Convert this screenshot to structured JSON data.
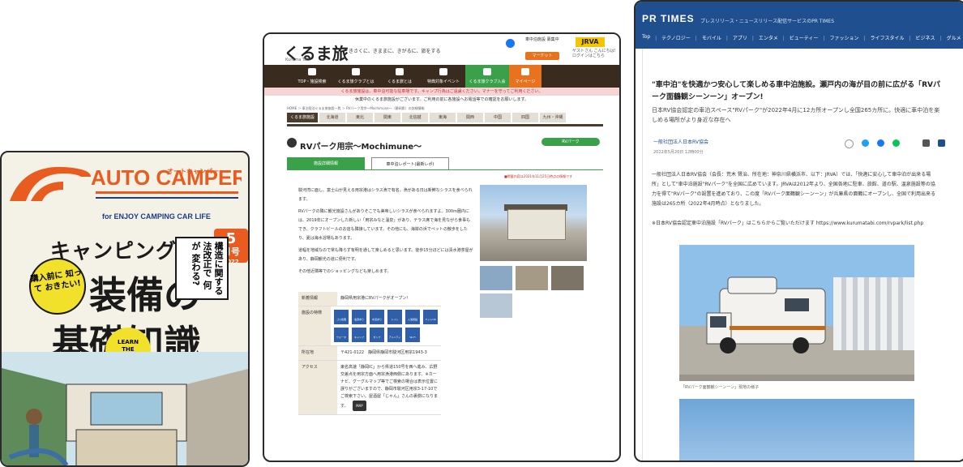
{
  "magazine": {
    "logo_text": "AUTO CAMPER",
    "logo_kana": "オートキャンパー",
    "catch": "for ENJOY CAMPING CAR LIFE",
    "issue_month": "5",
    "issue_unit": "月号",
    "issue_year": "2022",
    "title1": "キャンピングカー",
    "title2": "装備の",
    "title3": "基礎知識",
    "bubble": "購入前に 知って おきたい!",
    "vertical_text": "構造に関する 法改正で 何が 変わる?",
    "learn_badge": "LEARN\nTHE\nBASICS",
    "colors": {
      "orange": "#e85c1f",
      "yellow": "#f2e12a",
      "navy": "#1d3c86"
    }
  },
  "kurumatabi": {
    "logo": "くるま旅",
    "logo_sub": "Kuruma Tabi",
    "slogan": "きさくに、きままに、きがるに、旅をする",
    "badge": "車中泊施設 募集中",
    "market": "マーケット",
    "jrva": "JRVA",
    "jrva_sub": "ゲストさん こんにちは! ログインはこちら",
    "nav": [
      {
        "label": "TOP・施設検索"
      },
      {
        "label": "くるま旅クラブとは"
      },
      {
        "label": "くるま旅とは"
      },
      {
        "label": "特典対象イベント"
      },
      {
        "label": "くるま旅クラブ入会"
      },
      {
        "label": "マイページ"
      }
    ],
    "notice1": "くるま旅施設は、車中泊可能な駐車場です。キャンプ行為はご遠慮ください。マナーを守ってご利用ください。",
    "notice2": "休業中のくるま旅施設がございます。ご利用の前に各施設へお電話等での確認をお願いします。",
    "breadcrumb": "HOME ＞ 車泊宿泊ぐるま旅施設一覧 ＞ RVパーク用宗〜Mochimune〜（静岡県）の詳細情報",
    "regions": [
      "くるま旅施設",
      "北海道",
      "東北",
      "関東",
      "北信越",
      "東海",
      "関西",
      "中国",
      "四国",
      "九州・沖縄"
    ],
    "title": "RVパーク用宗〜Mochimune〜",
    "tag": "RVパーク",
    "tab1": "施設詳細情報",
    "tab2": "車中泊レポート(最新レポ)",
    "date_note": "■掲載内容は2021年11月25日時点の情報です",
    "body": [
      "駿河湾に面し、富士山が見える用宗港はシラス漁で有名。漁がある日は新鮮なシラスを食べられます。",
      "RVパークの隣に観光施設さんがありそこでも美味しいシラスが食べられますよ。300m圏内には、2019年にオープンした新しい「用宗みなと温泉」があり、テラス席で海を見ながら食事もでき、クラフトビールのお店も隣接しています。その他にも、海岸の浜でペットの散歩をしたり、夏は海水浴場もあります。",
      "道幅を地域なので常も降らず有明を通して楽しめると思います。徒歩15分ほどには清水港茶屋があり、静岡観光の道に便利です。",
      "その他近隣等でのショッピングなども楽しめます。"
    ],
    "table": [
      {
        "key": "新着情報",
        "value": "静岡県用宗港にRVパークがオープン!"
      },
      {
        "key": "施設の特徴",
        "value": ""
      },
      {
        "key": "所在地",
        "value": "〒421-0122　静岡県静岡市駿河区用宗1943-3"
      },
      {
        "key": "アクセス",
        "value": "東名高速「静岡IC」から県道150号を西へ進み、広野交差点を用宗方面へ用宗漁港西側にあります。※カーナビ、グーグルマップ等でご検索の場合は表示位置に誤りがございますので、静岡市駿河区用宗3-17-10でご検索下さい。屋酒屋「じゃん」さんの裏側になります。"
      }
    ],
    "features": [
      "ゴミ処理",
      "電源あり",
      "水道あり",
      "トイレ",
      "入浴施設",
      "ペットOK",
      "ウォータ",
      "キャンプ",
      "ダンプ",
      "アメニティ",
      "Wi-Fi"
    ],
    "map_button": "MAP"
  },
  "prtimes": {
    "logo": "PR TIMES",
    "logo_sub": "プレスリリース・ニュースリリース配信サービスのPR TIMES",
    "nav": [
      "Top",
      "テクノロジー",
      "モバイル",
      "アプリ",
      "エンタメ",
      "ビューティー",
      "ファッション",
      "ライフスタイル",
      "ビジネス",
      "グルメ"
    ],
    "title": "\"車中泊\"を快適かつ安心して楽しめる車中泊施設。瀬戸内の海が目の前に広がる「RVパーク面鶴観シーンーン」オープン!",
    "subtitle": "日本RV協会認定の車泊スペース\"RVパーク\"が2022年4月に12カ所オープンし全国265カ所に。快適に車中泊を楽しめる場所がより身近な存在へ",
    "org": "一般社団法人日本RV協会",
    "date": "2022年5月20日 12時00分",
    "body": "一般社団法人日本RV協会（会長：荒木 賢治、所在地：神奈川県横浜市、以下：JRVA）では、「快適に安心して車中泊が出来る場所」として\"車中泊施設\"RVパーク\"を全国に広めています。JRVAは2012年より、全国各地に駐車、旅館、道の駅、温泉施設等の協力を得て\"RVパーク\"の設置を進めており、この度「RVパーク面鶴観シーンーン」が兵庫県の面鶴にオープンし、全国で利用出来る施設は265カ所（2022年4月時点）となりました。",
    "link_note": "※日本RV協会認定車中泊施設「RVパーク」はこちらからご覧いただけます https://www.kurumatabi.com/rvpark/list.php",
    "caption": "「RVパーク面鶴観シーンーン」現地の様子",
    "colors": {
      "header": "#1f4f8f"
    }
  }
}
